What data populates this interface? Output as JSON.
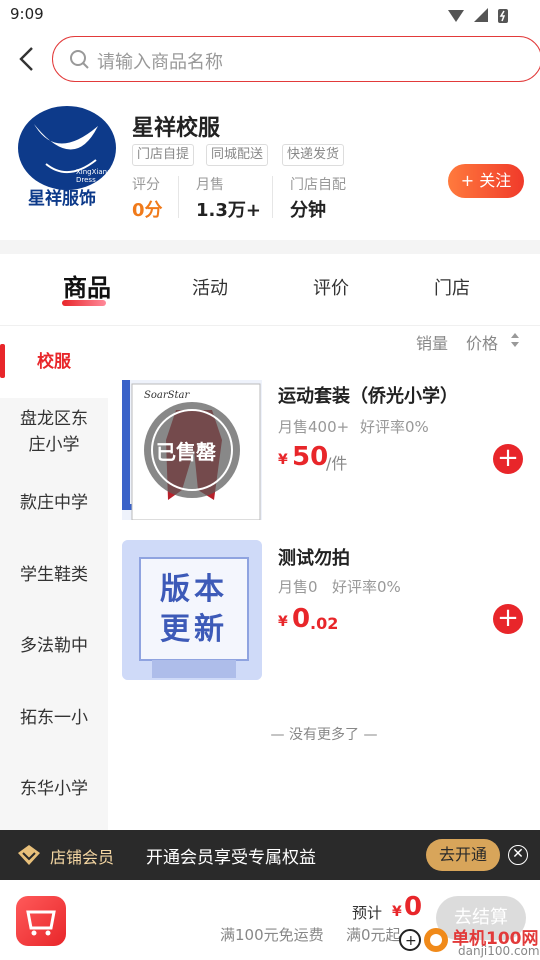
{
  "status_bar": {
    "time": "9:09"
  },
  "search": {
    "placeholder": "请输入商品名称"
  },
  "shop": {
    "logo_text": "星祥服饰",
    "logo_sub": "XingXiang Dress",
    "name": "星祥校服",
    "tags": [
      "门店自提",
      "同城配送",
      "快递发货"
    ],
    "stats": [
      {
        "label": "评分",
        "value": "0分"
      },
      {
        "label": "月售",
        "value": "1.3万+"
      },
      {
        "label": "门店自配",
        "value": "分钟"
      }
    ],
    "follow_label": "+ 关注"
  },
  "tabs": [
    "商品",
    "活动",
    "评价",
    "门店"
  ],
  "sidebar": [
    "校服",
    "盘龙区东庄小学",
    "款庄中学",
    "学生鞋类",
    "多法勒中",
    "拓东一小",
    "东华小学"
  ],
  "sort": {
    "sales": "销量",
    "price": "价格"
  },
  "products": [
    {
      "name": "运动套装（侨光小学）",
      "sold": "月售400+",
      "rating": "好评率0%",
      "currency": "¥",
      "price_int": "50",
      "price_dec": "",
      "unit": "/件",
      "badge": "已售罄",
      "image_text": "SoarStar"
    },
    {
      "name": "测试勿拍",
      "sold": "月售0",
      "rating": "好评率0%",
      "currency": "¥",
      "price_int": "0",
      "price_dec": ".02",
      "unit": "",
      "badge": "",
      "image_text": "版本更新"
    }
  ],
  "no_more": "— 没有更多了 —",
  "member": {
    "label": "店铺会员",
    "text": "开通会员享受专属权益",
    "button": "去开通"
  },
  "bottom": {
    "estimate_label": "预计",
    "currency": "¥",
    "estimate_value": "0",
    "free_shipping": "满100元免运费",
    "free_shipping2": "满0元起",
    "checkout": "去结算"
  },
  "watermark": {
    "text": "单机100网",
    "url": "danji100.com"
  },
  "colors": {
    "accent": "#e8262a",
    "member_bar": "#2a2a2a",
    "member_gold": "#d8a55a"
  }
}
